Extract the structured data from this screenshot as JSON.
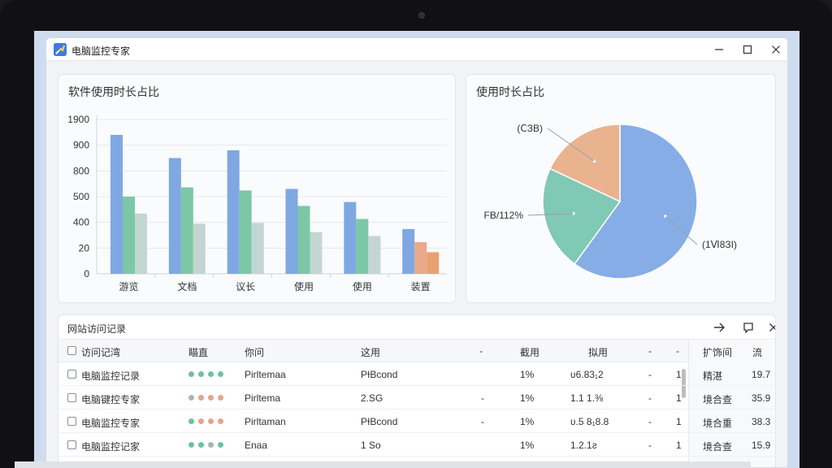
{
  "window": {
    "title": "电脑监控专家",
    "controls": [
      "minimize",
      "maximize",
      "close"
    ]
  },
  "bar_panel": {
    "title": "软件使用时长占比"
  },
  "pie_panel": {
    "title": "使用时长占比",
    "labels": [
      "(ⅭЗB)",
      "FB/112%",
      "(1Ⅵ8ЗІ)"
    ]
  },
  "chart_data": [
    {
      "type": "bar",
      "title": "软件使用时长占比",
      "y_tick_labels": [
        "0",
        "20",
        "400",
        "500",
        "800",
        "900",
        "1900"
      ],
      "categories": [
        "游览",
        "文档",
        "议长",
        "使用",
        "使用",
        "装置"
      ],
      "series": [
        {
          "color": "#7fa8e2",
          "values": [
            900,
            750,
            800,
            550,
            465,
            290
          ]
        },
        {
          "color": "#7cc8a6",
          "values": [
            500,
            560,
            540,
            440,
            355,
            205
          ]
        },
        {
          "color": "#c4d6d2",
          "values": [
            390,
            325,
            330,
            270,
            245,
            140
          ]
        }
      ],
      "bar_colors_last_category": [
        "#7fa8e2",
        "#eba88a",
        "#e9a172"
      ],
      "ylim": [
        0,
        1000
      ],
      "grid": true
    },
    {
      "type": "pie",
      "title": "使用时长占比",
      "slices": [
        {
          "label": "(1Ⅵ8ЗІ)",
          "value": 60,
          "color": "#86ade6"
        },
        {
          "label": "FB/112%",
          "value": 22,
          "color": "#80c9b5"
        },
        {
          "label": "(ⅭЗB)",
          "value": 18,
          "color": "#eab38f"
        }
      ]
    }
  ],
  "table": {
    "title": "网站访问记录",
    "columns": [
      "访问记湾",
      "瞄直",
      "你问",
      "这用",
      "-",
      "截用",
      "拟用",
      "-",
      "-"
    ],
    "right_columns": [
      "扩饰间",
      "流"
    ],
    "rows": [
      {
        "name": "电脑监控记录",
        "dots": [
          "#6cc39a",
          "#6cc39a",
          "#6cc39a",
          "#6cc39a"
        ],
        "c3": "Pirltemaa",
        "c4": "PƗBcond",
        "c5": "",
        "c6": "1%",
        "c7": "ʋ6.83₁2",
        "c8": "-",
        "c9": "1",
        "r1": "精湛",
        "r2": "19.7"
      },
      {
        "name": "电脑键控专家",
        "dots": [
          "#a8b8ae",
          "#e2a58a",
          "#e2a58a",
          "#e2a58a"
        ],
        "c3": "Pirltema",
        "c4": "2.SG",
        "c5": "-",
        "c6": "1%",
        "c7": "1.1 1.⅜",
        "c8": "-",
        "c9": "1",
        "r1": "境合查",
        "r2": "35.9"
      },
      {
        "name": "电脑监控专家",
        "dots": [
          "#6cc39a",
          "#e2a58a",
          "#e2a58a",
          "#e2a58a"
        ],
        "c3": "Pirltaman",
        "c4": "PƗBcond",
        "c5": "-",
        "c6": "1%",
        "c7": "ʋ.5 8₁8.8",
        "c8": "-",
        "c9": "1",
        "r1": "境合重",
        "r2": "38.3"
      },
      {
        "name": "电脑监控记家",
        "dots": [
          "#6cc39a",
          "#6cc39a",
          "#a8b8ae",
          "#6cc39a"
        ],
        "c3": "Enaa",
        "c4": "1 So",
        "c5": "",
        "c6": "1%",
        "c7": "1.2.1ƨ",
        "c8": "-",
        "c9": "1",
        "r1": "境合查",
        "r2": "15.9"
      }
    ]
  },
  "icons": [
    "app-icon",
    "minimize-icon",
    "maximize-icon",
    "close-icon",
    "export-icon",
    "popout-icon",
    "panel-close-icon"
  ]
}
